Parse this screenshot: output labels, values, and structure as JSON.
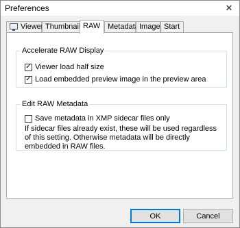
{
  "window": {
    "title": "Preferences",
    "close_glyph": "✕"
  },
  "tabs": [
    {
      "label": "Viewer",
      "icon": "monitor-icon"
    },
    {
      "label": "Thumbnails"
    },
    {
      "label": "RAW",
      "active": true
    },
    {
      "label": "Metadata"
    },
    {
      "label": "Image"
    },
    {
      "label": "Start"
    }
  ],
  "accelerate": {
    "title": "Accelerate RAW Display",
    "options": [
      {
        "label": "Viewer load half size",
        "checked": true
      },
      {
        "label": "Load embedded preview image in the preview area",
        "checked": true
      }
    ]
  },
  "edit_meta": {
    "title": "Edit RAW Metadata",
    "option": {
      "label": "Save metadata in XMP sidecar files only",
      "checked": false
    },
    "note": "If sidecar files already exist, these will be used regardless of this setting. Otherwise metadata will be directly embedded in RAW files."
  },
  "buttons": {
    "ok": "OK",
    "cancel": "Cancel"
  }
}
